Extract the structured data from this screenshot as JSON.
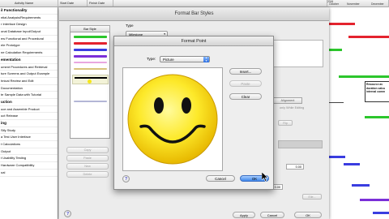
{
  "background": {
    "columns": {
      "name": "Activity Name",
      "start": "Start Date",
      "finish": "Finish Date"
    },
    "year": "2016",
    "months": [
      "October",
      "November",
      "December"
    ],
    "tasks": [
      {
        "label": "il Functionality",
        "bold": true
      },
      {
        "label": "ntial Analysis/Requirements",
        "bold": false
      },
      {
        "label": "r Interface Design",
        "bold": false
      },
      {
        "label": "onal Database Input/Output",
        "bold": false
      },
      {
        "label": "ew Functional and Procedural",
        "bold": false
      },
      {
        "label": "ele Prototype",
        "bold": false
      },
      {
        "label": "ne Calculation Requirements",
        "bold": false
      },
      {
        "label": "ementation",
        "bold": true
      },
      {
        "label": "ument Procedures and Retrieval",
        "bold": false
      },
      {
        "label": "ture Screens and Output Example",
        "bold": false
      },
      {
        "label": "hnical Review and Edit",
        "bold": false
      },
      {
        "label": "Documentation",
        "bold": false
      },
      {
        "label": "te Sample Data with Tutorial",
        "bold": false
      },
      {
        "label": "uction",
        "bold": true
      },
      {
        "label": "uce and Assemble Product",
        "bold": false
      },
      {
        "label": "uct Release",
        "bold": false
      },
      {
        "label": "ing",
        "bold": true
      },
      {
        "label": "Sify Study",
        "bold": false
      },
      {
        "label": "a Test User Interface",
        "bold": false
      },
      {
        "label": "t Calculations",
        "bold": false
      },
      {
        "label": "Output",
        "bold": false
      },
      {
        "label": "t Usability Testing",
        "bold": false
      },
      {
        "label": "Hardware Compatibility",
        "bold": false
      },
      {
        "label": "ual",
        "bold": false
      }
    ],
    "callout_text": "Resource av duration calcu internal comm",
    "colors": {
      "green": "#2cc62c",
      "red": "#e4232e",
      "blue": "#3a3de0",
      "purple": "#7b2fd8"
    }
  },
  "format_bar_styles": {
    "title": "Format Bar Styles",
    "bar_style_header": "Bar Style",
    "type_label": "Type",
    "type_value": "Milestone",
    "side_buttons": [
      "Copy",
      "Paste",
      "New",
      "Delete"
    ],
    "alignment_tab": "Alignment",
    "hint_text": "only While Editing",
    "mini_buttons": [
      "Flip",
      "Eile..."
    ],
    "num_value_1": "0.00",
    "num_value_2": "0.00",
    "footer_buttons": [
      "Apply",
      "Cancel",
      "OK"
    ]
  },
  "format_point": {
    "title": "Format Point",
    "type_label": "Type:",
    "type_value": "Picture",
    "insert_label": "Insert...",
    "paste_label": "Paste",
    "clear_label": "Clear",
    "cancel_label": "Cancel",
    "ok_label": "OK",
    "help_label": "?",
    "picture_icon": "smiley-face-icon"
  }
}
